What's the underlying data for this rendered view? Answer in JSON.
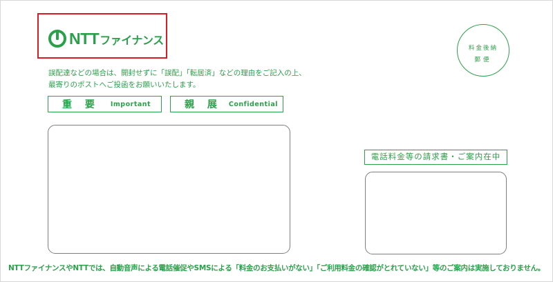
{
  "logo": {
    "brand": "NTT",
    "subtitle": "ファイナンス"
  },
  "notice": {
    "line1": "誤配達などの場合は、開封せずに「誤配」「転居済」などの理由をご記入の上、",
    "line2": "最寄りのポストへご投函をお願いいたします。"
  },
  "tags": {
    "important_jp": "重 要",
    "important_en": "Important",
    "confidential_jp": "親 展",
    "confidential_en": "Confidential"
  },
  "postage": {
    "line1": "料金後納",
    "line2": "郵便"
  },
  "statement_label": "電話料金等の請求書・ご案内在中",
  "footer": "NTTファイナンスやNTTでは、自動音声による電話催促やSMSによる「料金のお支払いがない」「ご利用料金の確認がとれていない」等のご案内は実施しておりません。",
  "colors": {
    "brand_green": "#2ba04a",
    "highlight_red": "#d71c24",
    "window_border": "#7d7d7d"
  },
  "icons": {
    "logo_mark": "ntt-loop-logo"
  }
}
